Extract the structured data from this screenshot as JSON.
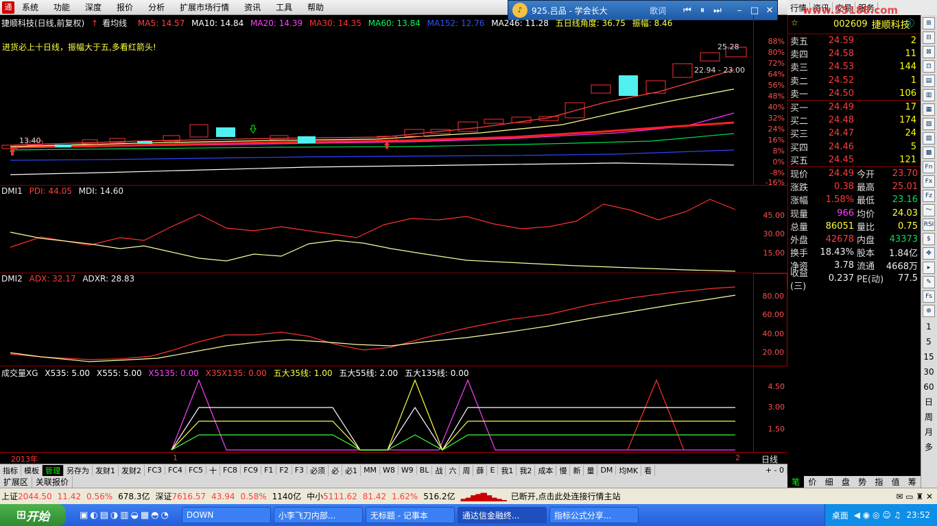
{
  "menubar": {
    "items": [
      "系统",
      "功能",
      "深度",
      "报价",
      "分析",
      "扩展市场行情",
      "资讯",
      "工具",
      "帮助"
    ],
    "notice": "通"
  },
  "music": {
    "title": "925.吕品 - 学会长大",
    "lyrics": "歌词"
  },
  "right_tabs": {
    "items": [
      "行情",
      "资讯",
      "交易",
      "服务"
    ],
    "watermark": "www.55188.com"
  },
  "chart": {
    "title": "捷顺科技(日线,前复权)",
    "view": "看均线",
    "ma": [
      {
        "label": "MA5: 14.57",
        "color": "#ff4040"
      },
      {
        "label": "MA10: 14.84",
        "color": "#ffffff"
      },
      {
        "label": "MA20: 14.39",
        "color": "#ff40ff"
      },
      {
        "label": "MA30: 14.35",
        "color": "#ff3030"
      },
      {
        "label": "MA60: 13.84",
        "color": "#00ff60"
      },
      {
        "label": "MA152: 12.76",
        "color": "#3050ff"
      },
      {
        "label": "MA246: 11.28",
        "color": "#ffffff"
      }
    ],
    "extra1": "五日线角度: 36.75",
    "extra2": "振幅: 8.46",
    "note": "进货必上十日线，振幅大于五,多看红箭头!",
    "label_low": "13.40",
    "label_high": "25.28",
    "label_range": "22.94 - 23.00",
    "pct_ticks": [
      "88%",
      "80%",
      "72%",
      "64%",
      "56%",
      "48%",
      "40%",
      "32%",
      "24%",
      "16%",
      "8%",
      "0%",
      "-8%",
      "-16%"
    ]
  },
  "dmi1": {
    "title": "DMI1",
    "pdi": "PDI: 44.05",
    "mdi": "MDI: 14.60",
    "ticks": [
      "45.00",
      "30.00",
      "15.00"
    ]
  },
  "dmi2": {
    "title": "DMI2",
    "adx": "ADX: 32.17",
    "adxr": "ADXR: 28.83",
    "ticks": [
      "80.00",
      "60.00",
      "40.00",
      "20.00"
    ]
  },
  "vol": {
    "title": "成交量XG",
    "items": [
      {
        "label": "X535: 5.00",
        "color": "#ffffff"
      },
      {
        "label": "X555: 5.00",
        "color": "#ffffff"
      },
      {
        "label": "X5135: 0.00",
        "color": "#ff40ff"
      },
      {
        "label": "X35X135: 0.00",
        "color": "#ff4040"
      },
      {
        "label": "五大35线: 1.00",
        "color": "#ffff40"
      },
      {
        "label": "五大55线: 2.00",
        "color": "#ffffff"
      },
      {
        "label": "五大135线: 0.00",
        "color": "#ffffff"
      }
    ],
    "ticks": [
      "4.50",
      "3.00",
      "1.50"
    ]
  },
  "timeline": {
    "year": "2013年",
    "m1": "1",
    "m2": "2",
    "period": "日线"
  },
  "bottom_tabs": [
    "指标",
    "模板",
    "管理",
    "另存为",
    "发财1",
    "发财2",
    "FC3",
    "FC4",
    "FC5",
    "十",
    "FC8",
    "FC9",
    "F1",
    "F2",
    "F3",
    "必须",
    "必",
    "必1",
    "MM",
    "W8",
    "W9",
    "BL",
    "战",
    "六",
    "周",
    "薛",
    "E",
    "我1",
    "我2",
    "成本",
    "慢",
    "新",
    "量",
    "DM",
    "均MK",
    "看"
  ],
  "ext_tabs": [
    "扩展区",
    "关联报价"
  ],
  "right_bottom_tabs": [
    "笔",
    "价",
    "细",
    "盘",
    "势",
    "指",
    "值",
    "筹"
  ],
  "quote": {
    "code": "002609",
    "name": "捷顺科技",
    "asks": [
      {
        "l": "卖五",
        "p": "24.59",
        "v": "2"
      },
      {
        "l": "卖四",
        "p": "24.58",
        "v": "11"
      },
      {
        "l": "卖三",
        "p": "24.53",
        "v": "144"
      },
      {
        "l": "卖二",
        "p": "24.52",
        "v": "1"
      },
      {
        "l": "卖一",
        "p": "24.50",
        "v": "106"
      }
    ],
    "bids": [
      {
        "l": "买一",
        "p": "24.49",
        "v": "17"
      },
      {
        "l": "买二",
        "p": "24.48",
        "v": "174"
      },
      {
        "l": "买三",
        "p": "24.47",
        "v": "24"
      },
      {
        "l": "买四",
        "p": "24.46",
        "v": "5"
      },
      {
        "l": "买五",
        "p": "24.45",
        "v": "121"
      }
    ],
    "stats": [
      {
        "a": "现价",
        "av": "24.49",
        "b": "今开",
        "bv": "23.70"
      },
      {
        "a": "涨跌",
        "av": "0.38",
        "b": "最高",
        "bv": "25.01"
      },
      {
        "a": "涨幅",
        "av": "1.58%",
        "b": "最低",
        "bv": "23.16"
      },
      {
        "a": "现量",
        "av": "966",
        "b": "均价",
        "bv": "24.03"
      },
      {
        "a": "总量",
        "av": "86051",
        "b": "量比",
        "bv": "0.75"
      },
      {
        "a": "外盘",
        "av": "42678",
        "b": "内盘",
        "bv": "43373"
      },
      {
        "a": "换手",
        "av": "18.43%",
        "b": "股本",
        "bv": "1.84亿"
      },
      {
        "a": "净资",
        "av": "3.78",
        "b": "流通",
        "bv": "4668万"
      },
      {
        "a": "收益(三)",
        "av": "0.237",
        "b": "PE(动)",
        "bv": "77.5"
      }
    ]
  },
  "status": {
    "sh_label": "上证",
    "sh_val": "2044.50",
    "sh_chg": "11.42",
    "sh_pct": "0.56%",
    "sh_amt": "678.3亿",
    "sz_label": "深证",
    "sz_val": "7616.57",
    "sz_chg": "43.94",
    "sz_pct": "0.58%",
    "sz_amt": "1140亿",
    "zx_label": "中小",
    "zx_val": "5111.62",
    "zx_chg": "81.42",
    "zx_pct": "1.62%",
    "zx_amt": "516.2亿",
    "msg": "已断开,点击此处连接行情主站"
  },
  "taskbar": {
    "start": "开始",
    "tasks": [
      "DOWN",
      "小李飞刀内部...",
      "无标题 - 记事本",
      "通达信金融终...",
      "指标公式分享..."
    ],
    "tray_label": "桌面",
    "time": "23:52"
  },
  "tools": [
    "日",
    "周",
    "月",
    "多"
  ],
  "tool_nums": [
    "1",
    "5",
    "15",
    "30",
    "60"
  ]
}
